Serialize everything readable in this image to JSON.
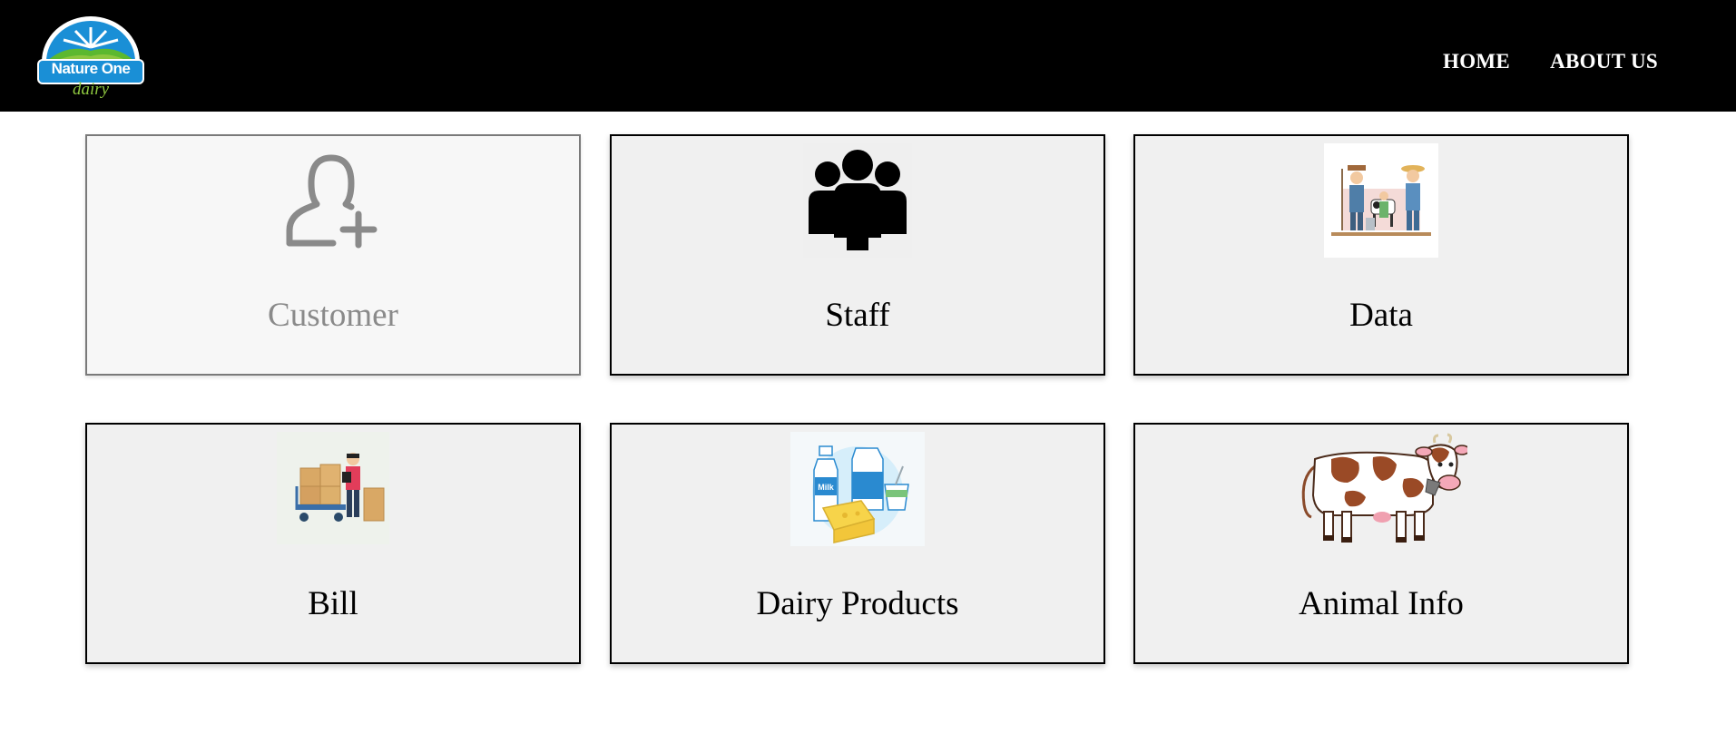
{
  "brand": {
    "logo_name": "Nature One",
    "logo_sub": "dairy",
    "colors": {
      "blue": "#1a8fd6",
      "green": "#8dc63f",
      "nav_bg": "#000000"
    }
  },
  "nav": {
    "items": [
      {
        "label": "HOME"
      },
      {
        "label": "ABOUT US"
      }
    ]
  },
  "cards": [
    {
      "label": "Customer",
      "icon": "add-user-icon",
      "state": "dimmed"
    },
    {
      "label": "Staff",
      "icon": "group-icon",
      "state": "normal"
    },
    {
      "label": "Data",
      "icon": "farmer-family-icon",
      "state": "normal"
    },
    {
      "label": "Bill",
      "icon": "delivery-worker-icon",
      "state": "normal"
    },
    {
      "label": "Dairy Products",
      "icon": "dairy-products-icon",
      "state": "normal"
    },
    {
      "label": "Animal Info",
      "icon": "cow-icon",
      "state": "normal"
    }
  ]
}
